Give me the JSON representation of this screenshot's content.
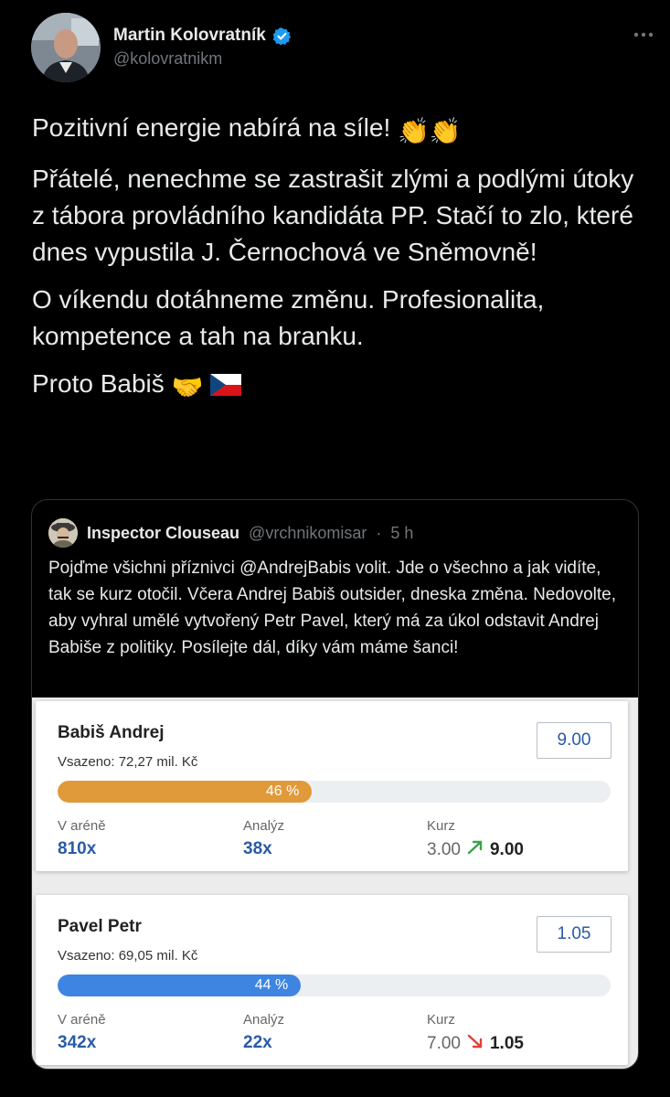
{
  "author": {
    "display_name": "Martin Kolovratník",
    "handle": "@kolovratnikm",
    "verified": true,
    "avatar_icon": "avatar-photo"
  },
  "tweet": {
    "paragraphs": [
      "Pozitivní energie nabírá na síle!",
      "Přátelé, nenechme se zastrašit zlými a podlými útoky z tábora provládního kandidáta PP. Stačí to zlo, které dnes vypustila J. Černochová ve Sněmovně!",
      "O víkendu dotáhneme změnu. Profesionalita, kompetence a tah na branku.",
      "Proto Babiš"
    ],
    "emoji_p1": "👏👏",
    "emoji_p4": "🤝",
    "flag_icon": "czech-flag-icon"
  },
  "quote": {
    "name": "Inspector Clouseau",
    "handle": "@vrchnikomisar",
    "separator": "·",
    "time": "5 h",
    "text": "Pojďme všichni příznivci @AndrejBabis volit. Jde o všechno a jak vidíte, tak se kurz otočil. Včera Andrej Babiš outsider, dneska změna. Nedovolte, aby vyhral umělé vytvořený Petr Pavel, který má za úkol odstavit Andrej Babiše z politiky. Posílejte dál, díky vám máme šanci!"
  },
  "cards": [
    {
      "name": "Babiš Andrej",
      "bet": "Vsazeno: 72,27 mil. Kč",
      "odds": "9.00",
      "percent_label": "46 %",
      "percent": 46,
      "bar_color": "#e09a3a",
      "arena_label": "V aréně",
      "arena_value": "810x",
      "analyz_label": "Analýz",
      "analyz_value": "38x",
      "kurz_label": "Kurz",
      "kurz_old": "3.00",
      "kurz_new": "9.00",
      "trend": "up",
      "trend_color": "#3aa34a"
    },
    {
      "name": "Pavel Petr",
      "bet": "Vsazeno: 69,05 mil. Kč",
      "odds": "1.05",
      "percent_label": "44 %",
      "percent": 44,
      "bar_color": "#3d85e0",
      "arena_label": "V aréně",
      "arena_value": "342x",
      "analyz_label": "Analýz",
      "analyz_value": "22x",
      "kurz_label": "Kurz",
      "kurz_old": "7.00",
      "kurz_new": "1.05",
      "trend": "down",
      "trend_color": "#e0413a"
    }
  ],
  "colors": {
    "background": "#000000",
    "text": "#e7e9ea",
    "muted": "#71767b",
    "verified": "#1d9bf0",
    "link_blue": "#2a5aa8"
  }
}
